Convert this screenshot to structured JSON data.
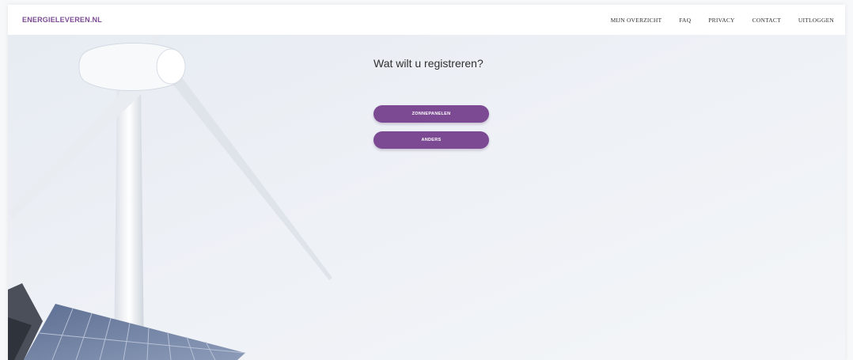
{
  "header": {
    "logo": "ENERGIELEVEREN.NL",
    "nav": [
      "MIJN OVERZICHT",
      "FAQ",
      "PRIVACY",
      "CONTACT",
      "UITLOGGEN"
    ]
  },
  "main": {
    "title": "Wat wilt u registreren?",
    "buttons": [
      "ZONNEPANELEN",
      "ANDERS"
    ]
  },
  "colors": {
    "accent": "#7b4a93",
    "background": "#eef1f6"
  }
}
